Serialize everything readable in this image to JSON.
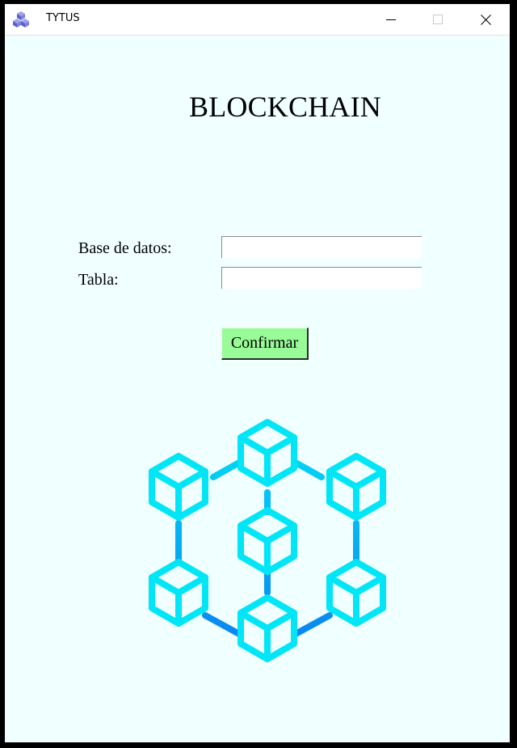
{
  "window": {
    "title": "TYTUS",
    "controls": {
      "minimize": "minimize-icon",
      "maximize": "maximize-icon",
      "close": "close-icon"
    }
  },
  "main": {
    "heading": "BLOCKCHAIN",
    "form": {
      "database_label": "Base de datos:",
      "database_value": "",
      "table_label": "Tabla:",
      "table_value": "",
      "confirm_label": "Confirmar"
    },
    "logo": "blockchain-cubes-icon"
  },
  "colors": {
    "background": "#f0ffff",
    "confirm_button": "#98fb98",
    "logo_gradient_top": "#00e5f5",
    "logo_gradient_bottom": "#0a7cf0",
    "app_icon": "#6b6fd6"
  }
}
